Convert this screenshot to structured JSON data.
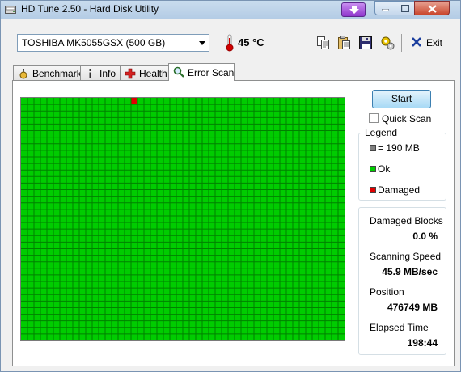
{
  "window": {
    "title": "HD Tune 2.50 - Hard Disk Utility"
  },
  "toolbar": {
    "drive": "TOSHIBA MK5055GSX (500 GB)",
    "temperature": "45 °C",
    "exit_label": "Exit"
  },
  "tabs": [
    {
      "label": "Benchmark",
      "active": false
    },
    {
      "label": "Info",
      "active": false
    },
    {
      "label": "Health",
      "active": false
    },
    {
      "label": "Error Scan",
      "active": true
    }
  ],
  "scan": {
    "start_label": "Start",
    "quick_scan_label": "Quick Scan",
    "quick_scan_checked": false,
    "grid": {
      "cols": 50,
      "rows": 37,
      "damaged_blocks": [
        {
          "row": 0,
          "col": 17
        }
      ]
    }
  },
  "legend": {
    "title": "Legend",
    "block_size": "= 190 MB",
    "ok": "Ok",
    "damaged": "Damaged"
  },
  "stats": {
    "damaged_blocks_label": "Damaged Blocks",
    "damaged_blocks_value": "0.0 %",
    "scanning_speed_label": "Scanning Speed",
    "scanning_speed_value": "45.9 MB/sec",
    "position_label": "Position",
    "position_value": "476749 MB",
    "elapsed_label": "Elapsed Time",
    "elapsed_value": "198:44"
  },
  "colors": {
    "ok": "#00cc00",
    "damaged": "#e00000",
    "block_neutral": "#808080",
    "grid_line": "#008000"
  }
}
